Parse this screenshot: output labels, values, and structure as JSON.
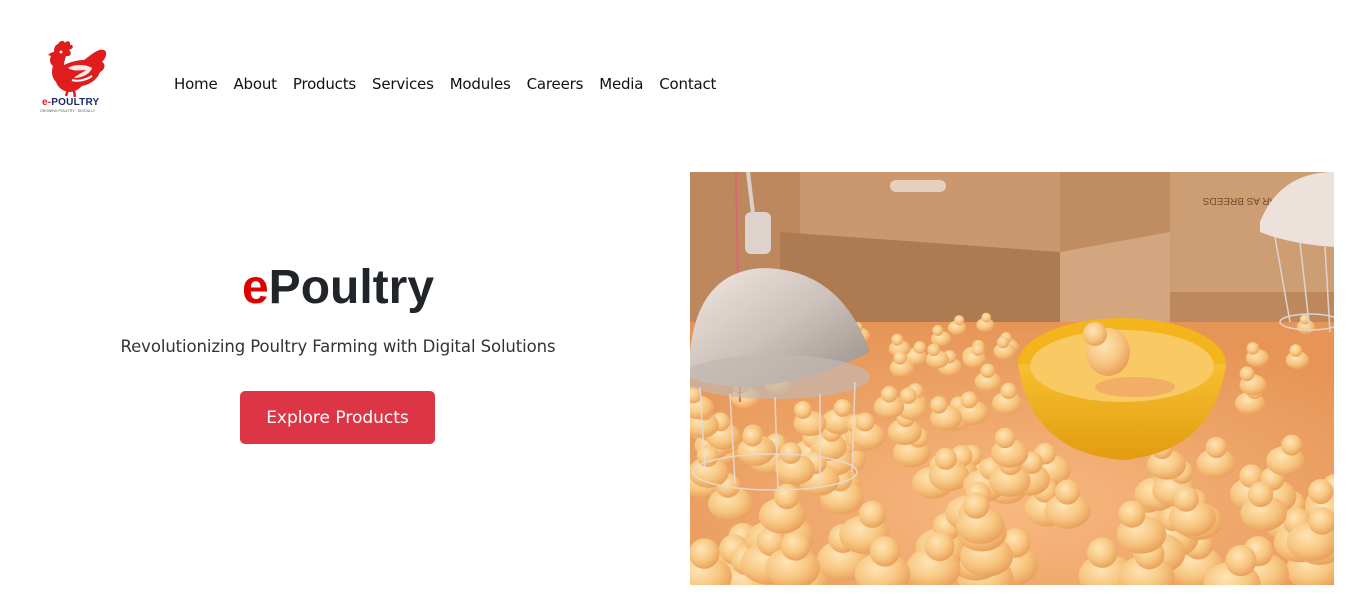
{
  "brand": {
    "logo_text_prefix": "e-",
    "logo_text_main": "POULTRY",
    "logo_tagline": "GROWING POULTRY · DIGITALLY",
    "accent_color": "#e01d1d"
  },
  "nav": {
    "items": [
      {
        "label": "Home"
      },
      {
        "label": "About"
      },
      {
        "label": "Products"
      },
      {
        "label": "Services"
      },
      {
        "label": "Modules"
      },
      {
        "label": "Careers"
      },
      {
        "label": "Media"
      },
      {
        "label": "Contact"
      }
    ]
  },
  "hero": {
    "title_accent": "e",
    "title_rest": "Poultry",
    "subtitle": "Revolutionizing Poultry Farming with Digital Solutions",
    "cta_label": "Explore Products",
    "cta_color": "#dc3545",
    "image_icon": "chicks-under-heat-lamp-photo"
  }
}
